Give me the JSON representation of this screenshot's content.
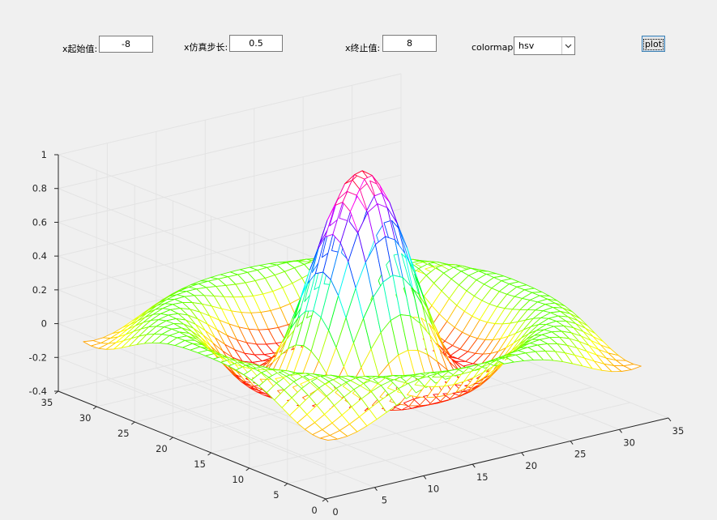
{
  "controls": {
    "x_start_label": "x起始值:",
    "x_start_value": "-8",
    "x_step_label": "x仿真步长:",
    "x_step_value": "0.5",
    "x_end_label": "x终止值:",
    "x_end_value": "8",
    "colormap_label": "colormap",
    "colormap_value": "hsv",
    "plot_button": "plot"
  },
  "chart_data": {
    "type": "mesh",
    "function": "sin(r)/r, r = sqrt(x^2 + y^2)",
    "grid_x": {
      "start": -8,
      "step": 0.5,
      "end": 8
    },
    "grid_y": {
      "start": -8,
      "step": 0.5,
      "end": 8
    },
    "grid_points": 33,
    "colormap": "hsv",
    "x_ticks": [
      "0",
      "5",
      "10",
      "15",
      "20",
      "25",
      "30",
      "35"
    ],
    "y_ticks": [
      "0",
      "5",
      "10",
      "15",
      "20",
      "25",
      "30",
      "35"
    ],
    "z_ticks": [
      "-0.4",
      "-0.2",
      "0",
      "0.2",
      "0.4",
      "0.6",
      "0.8",
      "1"
    ],
    "xlim": [
      0,
      35
    ],
    "ylim": [
      0,
      35
    ],
    "zlim": [
      -0.4,
      1
    ],
    "grid": true,
    "box": "open 3-D axes with gridlines"
  }
}
